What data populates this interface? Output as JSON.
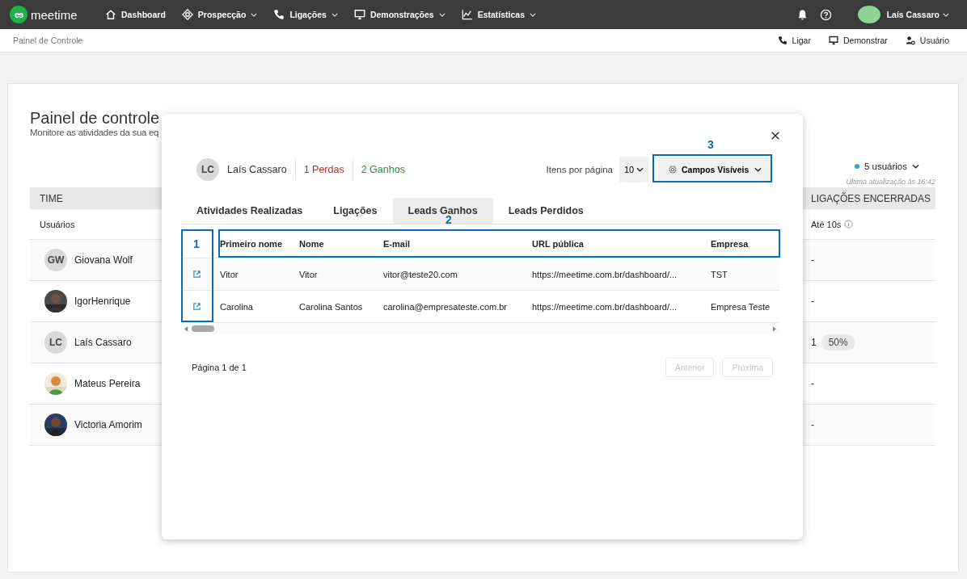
{
  "topbar": {
    "logo_mark": "eɘ",
    "brand": "meetime",
    "nav": [
      {
        "label": "Dashboard",
        "dropdown": false
      },
      {
        "label": "Prospecção",
        "dropdown": true
      },
      {
        "label": "Ligações",
        "dropdown": true
      },
      {
        "label": "Demonstrações",
        "dropdown": true
      },
      {
        "label": "Estatísticas",
        "dropdown": true
      }
    ],
    "user": "Laís Cassaro"
  },
  "subbar": {
    "breadcrumb": "Painel de Controle",
    "actions": [
      "Ligar",
      "Demonstrar",
      "Usuário"
    ]
  },
  "page": {
    "title": "Painel de controle",
    "subtitle": "Monitore as atividades da sua eq",
    "users_filter": "5 usuários",
    "last_update": "Última atualização às 16:42",
    "table": {
      "group_left": "TIME",
      "group_right": "LIGAÇÕES ENCERRADAS",
      "column_left": "Usuários",
      "column_right": "Até 10s",
      "rows": [
        {
          "name": "Giovana Wolf",
          "initials": "GW",
          "value": "-"
        },
        {
          "name": "IgorHenrique",
          "value": "-"
        },
        {
          "name": "Laís Cassaro",
          "initials": "LC",
          "value": "1",
          "badge": "50%"
        },
        {
          "name": "Mateus Pereira",
          "value": "-"
        },
        {
          "name": "Victoria Amorim",
          "value": "-"
        }
      ]
    }
  },
  "modal": {
    "initials": "LC",
    "user": "Laís Cassaro",
    "losses": "1 Perdas",
    "wins": "2 Ganhos",
    "per_page_label": "Itens por página",
    "per_page": "10",
    "fields_button": "Campos Visíveis",
    "tabs": [
      {
        "label": "Atividades Realizadas",
        "selected": false
      },
      {
        "label": "Ligações",
        "selected": false
      },
      {
        "label": "Leads Ganhos",
        "selected": true
      },
      {
        "label": "Leads Perdidos",
        "selected": false
      }
    ],
    "columns": [
      "Primeiro nome",
      "Nome",
      "E-mail",
      "URL pública",
      "Empresa"
    ],
    "rows": [
      [
        "Vitor",
        "Vitor",
        "vitor@teste20.com",
        "https://meetime.com.br/dashboard/...",
        "TST"
      ],
      [
        "Carolina",
        "Carolina Santos",
        "carolina@empresateste.com.br",
        "https://meetime.com.br/dashboard/...",
        "Empresa Teste"
      ]
    ],
    "page_info": "Página 1 de 1",
    "pager": [
      {
        "label": "Anterior",
        "disabled": true
      },
      {
        "label": "Próxima",
        "disabled": true
      }
    ],
    "annotations": [
      "1",
      "2",
      "3"
    ]
  }
}
